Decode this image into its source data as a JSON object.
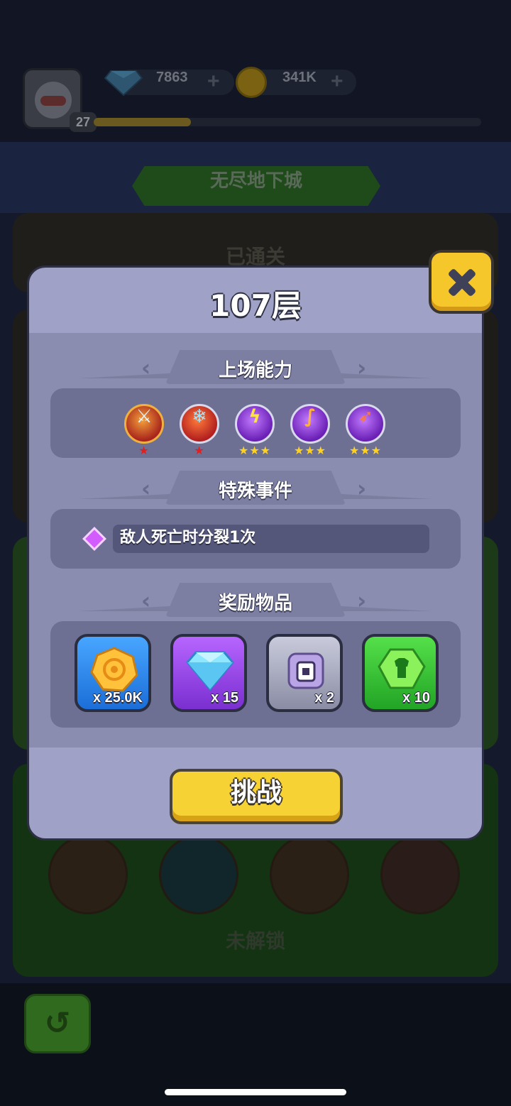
{
  "header": {
    "player_level": "27",
    "xp_progress": 0.25,
    "gems": "7863",
    "coins": "341K",
    "plus_symbol": "+",
    "avatar_icon": "player-avatar",
    "gem_icon": "diamond-icon",
    "coin_icon": "gold-coin-icon"
  },
  "background": {
    "mode_title": "无尽地下城",
    "card1_label": "已通关",
    "card3_label": "未解锁",
    "back_icon": "return-arrow-icon"
  },
  "modal": {
    "title": "107层",
    "close_icon": "close-x-icon",
    "abilities_heading": "上场能力",
    "abilities": [
      {
        "icon": "sword-icon",
        "stars": "★",
        "star_color": "red"
      },
      {
        "icon": "ice-crystal-icon",
        "stars": "★",
        "star_color": "red"
      },
      {
        "icon": "lightning-icon",
        "stars": "★★★",
        "star_color": "gold"
      },
      {
        "icon": "staff-icon",
        "stars": "★★★",
        "star_color": "gold"
      },
      {
        "icon": "rocket-icon",
        "stars": "★★★",
        "star_color": "gold"
      }
    ],
    "events_heading": "特殊事件",
    "event": {
      "icon": "purple-gem-icon",
      "text": "敌人死亡时分裂1次"
    },
    "rewards_heading": "奖励物品",
    "rewards": [
      {
        "icon": "gold-coin-icon",
        "quantity": "x 25.0K",
        "color": "blue"
      },
      {
        "icon": "diamond-icon",
        "quantity": "x 15",
        "color": "purple"
      },
      {
        "icon": "equipment-scroll-icon",
        "quantity": "x 2",
        "color": "grey"
      },
      {
        "icon": "armor-gem-icon",
        "quantity": "x 10",
        "color": "green"
      }
    ],
    "challenge_label": "挑战"
  },
  "colors": {
    "modal_bg": "#9fa2c6",
    "button_yellow": "#f7d234",
    "accent_purple": "#d35cff"
  }
}
